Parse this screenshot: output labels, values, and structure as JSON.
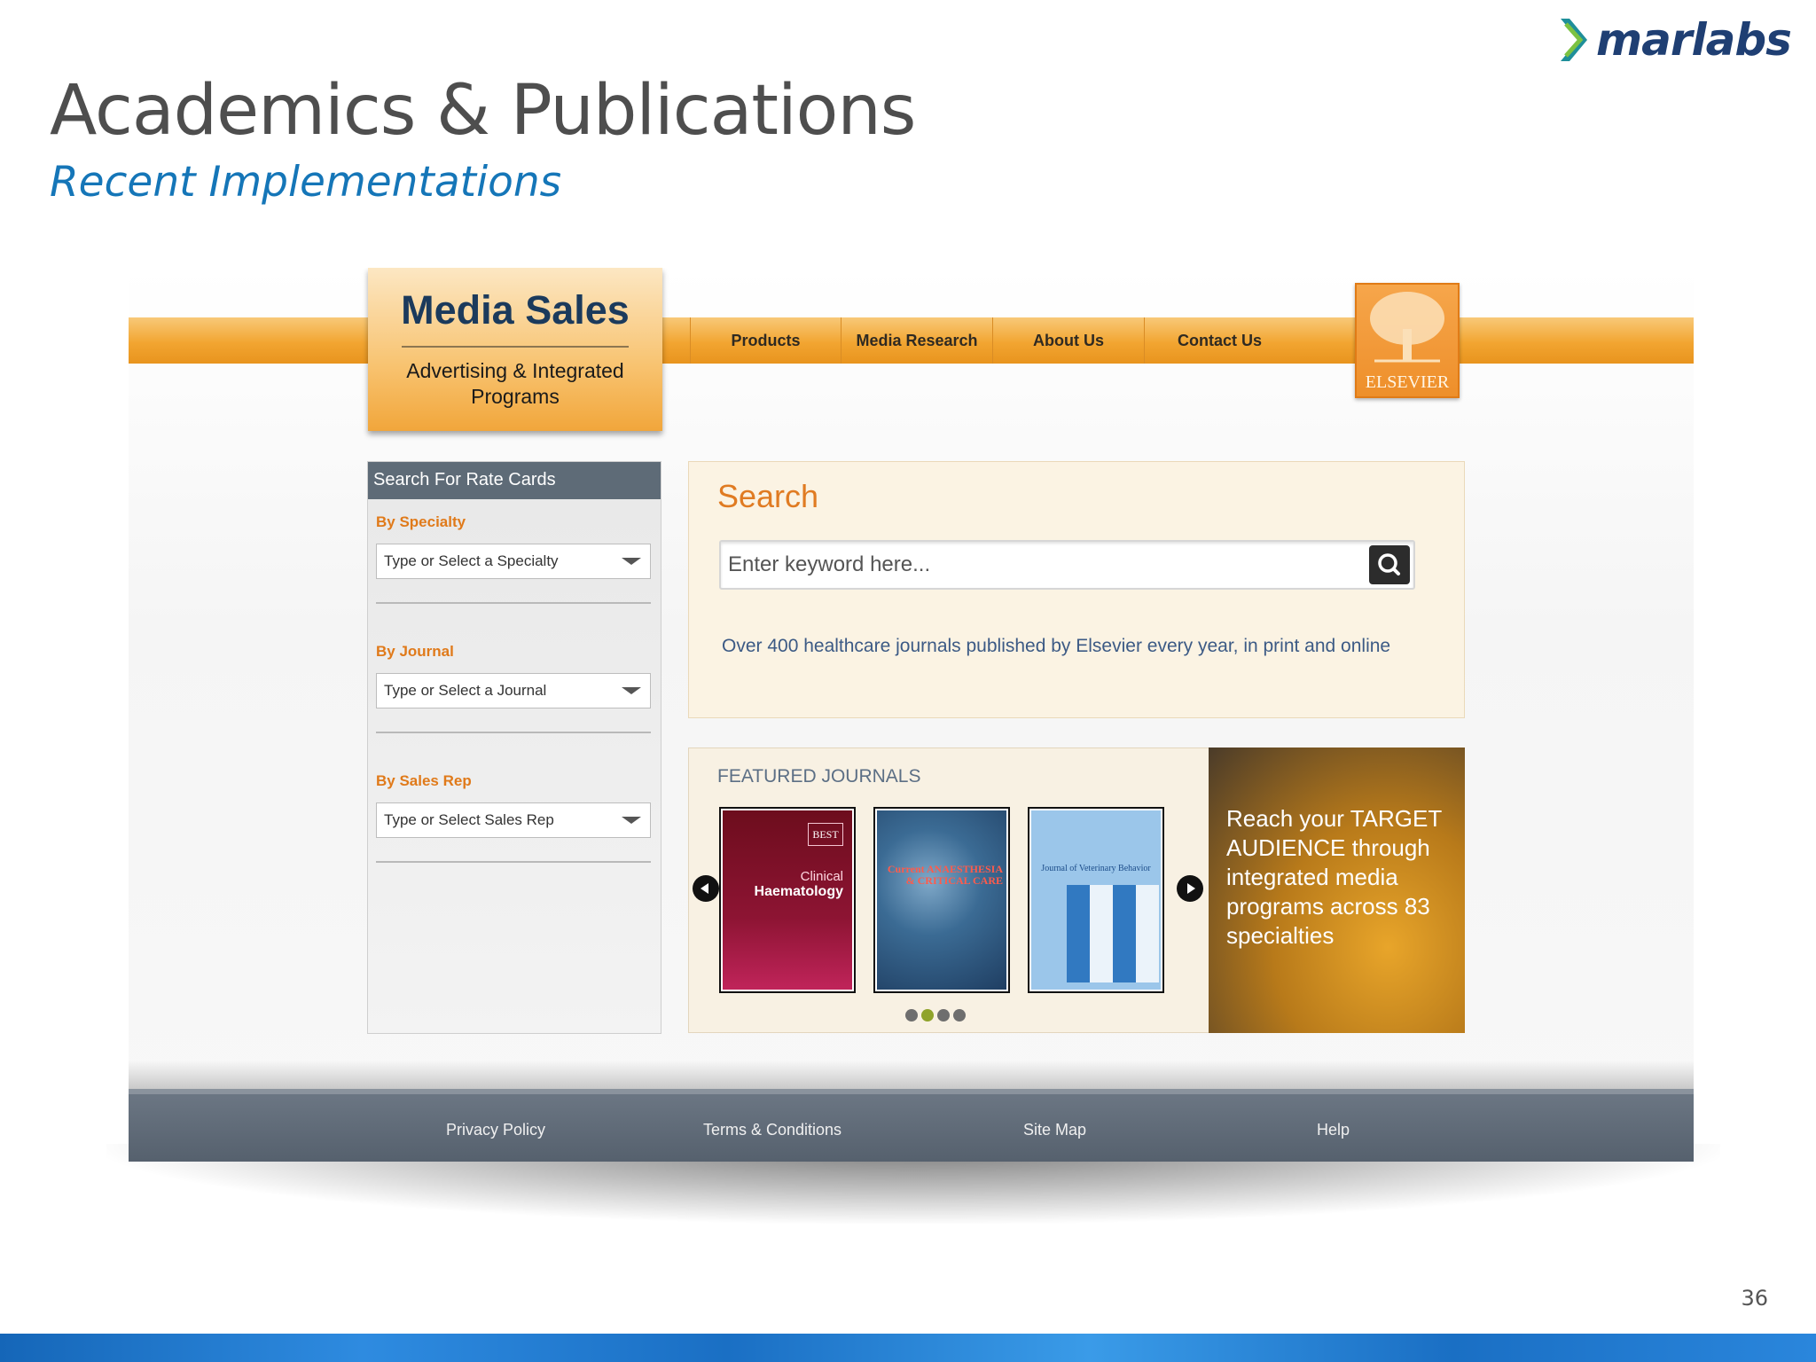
{
  "slide": {
    "logo_text": "marlabs",
    "title": "Academics & Publications",
    "subtitle": "Recent Implementations",
    "page_number": "36"
  },
  "site": {
    "brand": {
      "title": "Media Sales",
      "subtitle": "Advertising & Integrated Programs"
    },
    "nav": [
      "Products",
      "Media Research",
      "About Us",
      "Contact Us"
    ],
    "publisher_logo_text": "ELSEVIER",
    "sidebar": {
      "heading": "Search For Rate Cards",
      "filters": [
        {
          "label": "By Specialty",
          "placeholder": "Type or Select a Specialty"
        },
        {
          "label": "By Journal",
          "placeholder": "Type or Select a Journal"
        },
        {
          "label": "By Sales Rep",
          "placeholder": "Type or Select Sales Rep"
        }
      ]
    },
    "search": {
      "title": "Search",
      "placeholder": "Enter keyword here...",
      "description": "Over 400 healthcare journals published by Elsevier every year, in print and online"
    },
    "featured": {
      "title": "FEATURED JOURNALS",
      "covers": [
        {
          "badge": "BEST",
          "line1": "Clinical",
          "line2": "Haematology"
        },
        {
          "title": "Current ANAESTHESIA & CRITICAL CARE"
        },
        {
          "title": "Journal of Veterinary Behavior"
        }
      ],
      "carousel_dots": 4,
      "active_dot": 1
    },
    "promo": "Reach your TARGET AUDIENCE through integrated media programs across 83 specialties",
    "footer": [
      "Privacy Policy",
      "Terms & Conditions",
      "Site Map",
      "Help"
    ]
  },
  "colors": {
    "accent_orange": "#f2a531",
    "title_gray": "#4e4e4e",
    "subtitle_blue": "#1576b8",
    "logo_navy": "#1f3f73",
    "footer_slate": "#5e6b77"
  }
}
